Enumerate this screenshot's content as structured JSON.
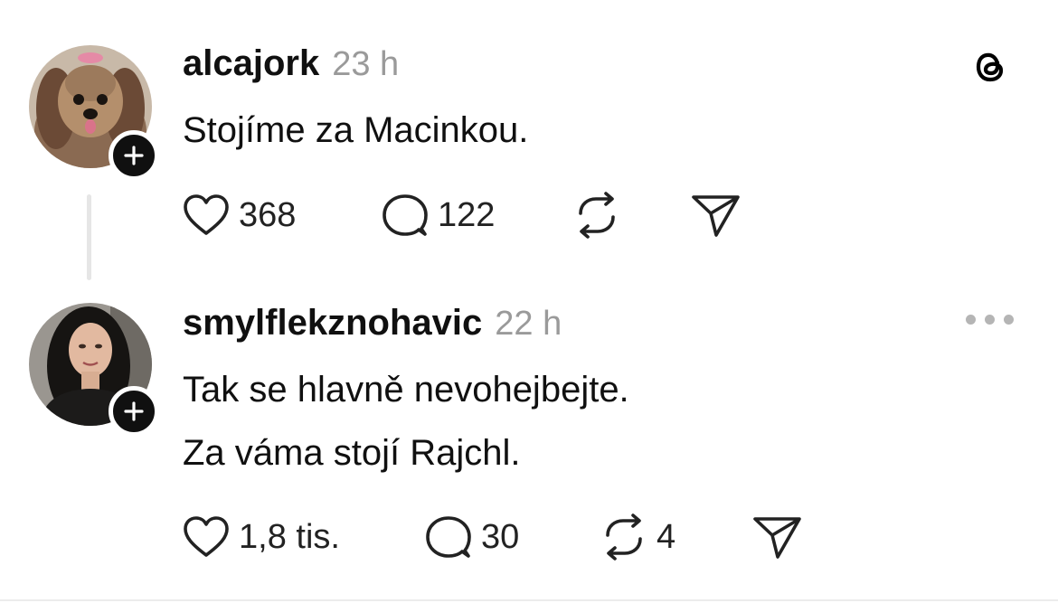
{
  "posts": [
    {
      "username": "alcajork",
      "time": "23 h",
      "lines": [
        "Stojíme za Macinkou."
      ],
      "likes": "368",
      "replies": "122",
      "reposts": "",
      "avatar_icon": "dog-avatar"
    },
    {
      "username": "smylflekznohavic",
      "time": "22 h",
      "lines": [
        "Tak se hlavně nevohejbejte.",
        "Za váma stojí Rajchl."
      ],
      "likes": "1,8 tis.",
      "replies": "30",
      "reposts": "4",
      "avatar_icon": "woman-avatar"
    }
  ],
  "icons": {
    "app_logo": "threads-logo",
    "like": "heart-icon",
    "reply": "speech-bubble-icon",
    "repost": "repost-icon",
    "share": "send-icon",
    "more": "more-dots-icon",
    "follow": "plus-icon"
  },
  "colors": {
    "text": "#101010",
    "muted": "#9a9a9a",
    "badge": "#101010"
  }
}
